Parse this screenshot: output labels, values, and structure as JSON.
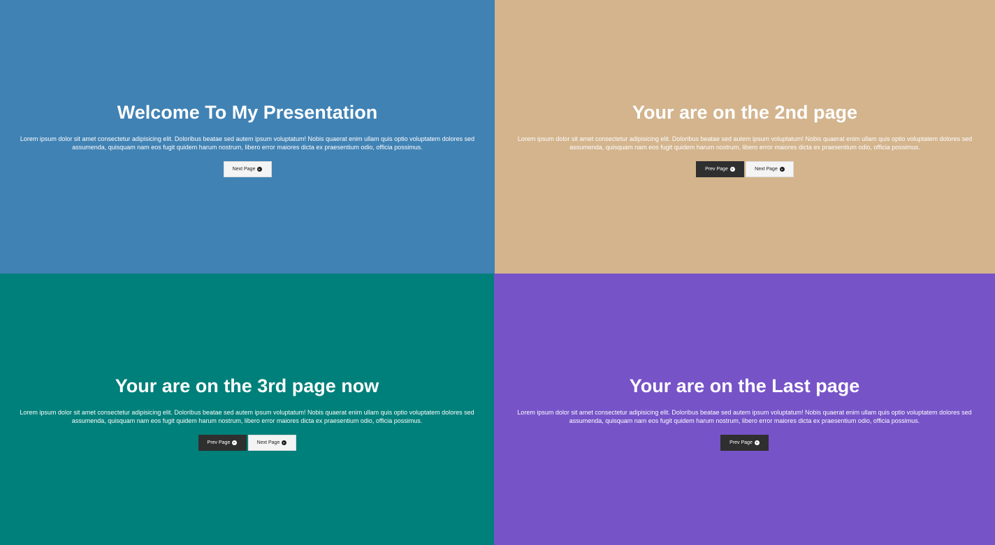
{
  "colors": {
    "panel_1_bg": "#4082b4",
    "panel_2_bg": "#d3b48d",
    "panel_3_bg": "#00807a",
    "panel_4_bg": "#7753c8",
    "button_light": "#f4f4f4",
    "button_dark": "#2f2f2f"
  },
  "pages": [
    {
      "title": "Welcome To My Presentation",
      "body": "Lorem ipsum dolor sit amet consectetur adipisicing elit. Doloribus beatae sed autem ipsum voluptatum! Nobis quaerat enim ullam quis optio voluptatem dolores sed assumenda, quisquam nam eos fugit quidem harum nostrum, libero error maiores dicta ex praesentium odio, officia possimus.",
      "next_label": "Next Page",
      "next_icon": "arrow-circle-down-icon"
    },
    {
      "title": "Your are on the 2nd page",
      "body": "Lorem ipsum dolor sit amet consectetur adipisicing elit. Doloribus beatae sed autem ipsum voluptatum! Nobis quaerat enim ullam quis optio voluptatem dolores sed assumenda, quisquam nam eos fugit quidem harum nostrum, libero error maiores dicta ex praesentium odio, officia possimus.",
      "prev_label": "Prev Page",
      "prev_icon": "arrow-circle-up-icon",
      "next_label": "Next Page",
      "next_icon": "arrow-circle-down-icon"
    },
    {
      "title": "Your are on the 3rd page now",
      "body": "Lorem ipsum dolor sit amet consectetur adipisicing elit. Doloribus beatae sed autem ipsum voluptatum! Nobis quaerat enim ullam quis optio voluptatem dolores sed assumenda, quisquam nam eos fugit quidem harum nostrum, libero error maiores dicta ex praesentium odio, officia possimus.",
      "prev_label": "Prev Page",
      "prev_icon": "arrow-circle-up-icon",
      "next_label": "Next Page",
      "next_icon": "arrow-circle-down-icon"
    },
    {
      "title": "Your are on the Last page",
      "body": "Lorem ipsum dolor sit amet consectetur adipisicing elit. Doloribus beatae sed autem ipsum voluptatum! Nobis quaerat enim ullam quis optio voluptatem dolores sed assumenda, quisquam nam eos fugit quidem harum nostrum, libero error maiores dicta ex praesentium odio, officia possimus.",
      "prev_label": "Prev Page",
      "prev_icon": "arrow-circle-up-icon"
    }
  ]
}
